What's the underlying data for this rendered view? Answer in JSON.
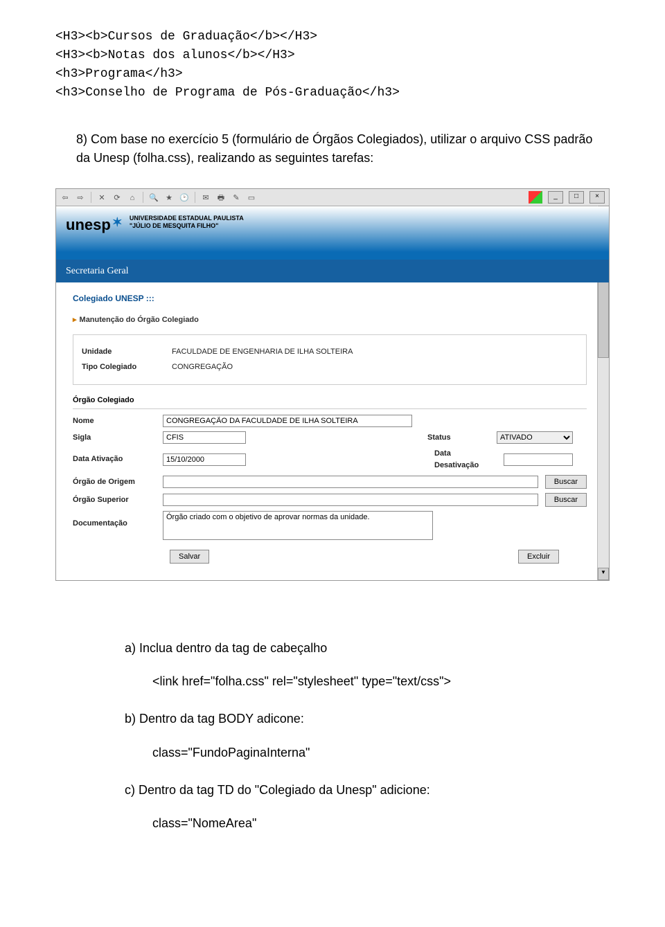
{
  "code": {
    "l1": "<H3><b>Cursos de Graduação</b></H3>",
    "l2": "<H3><b>Notas dos alunos</b></H3>",
    "l3": "<h3>Programa</h3>",
    "l4": "<h3>Conselho de Programa de Pós-Graduação</h3>"
  },
  "paragraph": "8) Com base no exercício 5 (formulário de Órgãos Colegiados), utilizar o arquivo CSS padrão da Unesp (folha.css), realizando as seguintes tarefas:",
  "ui": {
    "logo": "unesp",
    "uni_line1": "UNIVERSIDADE ESTADUAL PAULISTA",
    "uni_line2": "\"JÚLIO DE MESQUITA FILHO\"",
    "secretaria": "Secretaria Geral",
    "section": "Colegiado UNESP :::",
    "subsection": "Manutenção do Órgão Colegiado",
    "unidade_lbl": "Unidade",
    "unidade_val": "FACULDADE DE ENGENHARIA DE ILHA SOLTEIRA",
    "tipo_lbl": "Tipo Colegiado",
    "tipo_val": "CONGREGAÇÃO",
    "panel2": "Órgão Colegiado",
    "nome_lbl": "Nome",
    "nome_val": "CONGREGAÇÃO DA FACULDADE DE ILHA SOLTEIRA",
    "sigla_lbl": "Sigla",
    "sigla_val": "CFIS",
    "status_lbl": "Status",
    "status_val": "ATIVADO",
    "dataativ_lbl": "Data Ativação",
    "dataativ_val": "15/10/2000",
    "datadesat_lbl": "Data Desativação",
    "datadesat_val": "",
    "origem_lbl": "Órgão de Origem",
    "origem_val": "",
    "superior_lbl": "Órgão Superior",
    "superior_val": "",
    "doc_lbl": "Documentação",
    "doc_val": "Órgão criado com o objetivo de aprovar normas da unidade.",
    "buscar": "Buscar",
    "salvar": "Salvar",
    "excluir": "Excluir"
  },
  "answers": {
    "a": "a)  Inclua dentro da tag de cabeçalho",
    "a_sub": "<link href=\"folha.css\" rel=\"stylesheet\" type=\"text/css\">",
    "b": "b)  Dentro da tag BODY adicone:",
    "b_sub": "class=\"FundoPaginaInterna\"",
    "c": "c)  Dentro da tag TD do \"Colegiado da Unesp\" adicione:",
    "c_sub": "class=\"NomeArea\""
  }
}
